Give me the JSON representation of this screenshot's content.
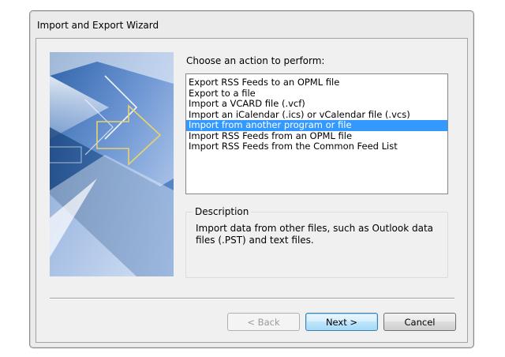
{
  "window": {
    "title": "Import and Export Wizard"
  },
  "wizard": {
    "prompt": "Choose an action to perform:",
    "actions": [
      "Export RSS Feeds to an OPML file",
      "Export to a file",
      "Import a VCARD file (.vcf)",
      "Import an iCalendar (.ics) or vCalendar file (.vcs)",
      "Import from another program or file",
      "Import RSS Feeds from an OPML file",
      "Import RSS Feeds from the Common Feed List"
    ],
    "selected_action": "Import from another program or file",
    "description_label": "Description",
    "description_text": "Import data from other files, such as Outlook data files (.PST) and text files."
  },
  "buttons": {
    "back": "< Back",
    "next": "Next >",
    "cancel": "Cancel"
  },
  "colors": {
    "selection": "#3399ff",
    "art_blue_dark": "#1c4f8f",
    "art_blue_light": "#a8c4ea",
    "art_arrow": "#e8d46a"
  },
  "icons": [
    "wizard-banner-arrow-graphic"
  ]
}
